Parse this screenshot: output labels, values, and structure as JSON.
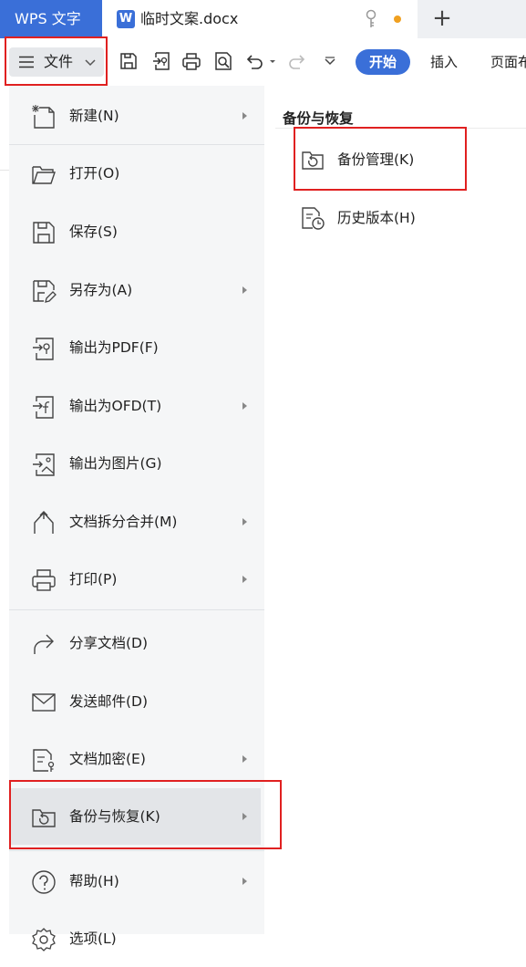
{
  "tabbar": {
    "app_title": "WPS 文字",
    "doc_icon_letter": "W",
    "doc_name": "临时文案.docx",
    "unsaved_dot_color": "#f0a020",
    "new_tab_symbol": "+"
  },
  "toolbar": {
    "file_label": "文件",
    "tabs": [
      "开始",
      "插入",
      "页面布"
    ],
    "accent_color": "#3a6fd8",
    "icons": [
      "save-icon",
      "export-pdf-icon",
      "print-icon",
      "print-preview-icon",
      "undo-icon",
      "undo-dropdown-icon",
      "redo-icon",
      "more-dropdown-icon"
    ]
  },
  "file_menu": {
    "items": [
      {
        "label": "新建(N)",
        "icon": "new-doc-icon",
        "has_submenu": true
      },
      {
        "label": "打开(O)",
        "icon": "folder-open-icon",
        "has_submenu": false
      },
      {
        "label": "保存(S)",
        "icon": "save-icon",
        "has_submenu": false
      },
      {
        "label": "另存为(A)",
        "icon": "save-as-icon",
        "has_submenu": true
      },
      {
        "label": "输出为PDF(F)",
        "icon": "export-pdf-icon",
        "has_submenu": false
      },
      {
        "label": "输出为OFD(T)",
        "icon": "export-ofd-icon",
        "has_submenu": true
      },
      {
        "label": "输出为图片(G)",
        "icon": "export-image-icon",
        "has_submenu": false
      },
      {
        "label": "文档拆分合并(M)",
        "icon": "split-merge-icon",
        "has_submenu": true
      },
      {
        "label": "打印(P)",
        "icon": "print-icon",
        "has_submenu": true
      },
      {
        "label": "分享文档(D)",
        "icon": "share-icon",
        "has_submenu": false
      },
      {
        "label": "发送邮件(D)",
        "icon": "mail-icon",
        "has_submenu": false
      },
      {
        "label": "文档加密(E)",
        "icon": "encrypt-icon",
        "has_submenu": true
      },
      {
        "label": "备份与恢复(K)",
        "icon": "backup-restore-icon",
        "has_submenu": true,
        "active": true
      },
      {
        "label": "帮助(H)",
        "icon": "help-icon",
        "has_submenu": true
      },
      {
        "label": "选项(L)",
        "icon": "options-icon",
        "has_submenu": false
      }
    ]
  },
  "submenu": {
    "title": "备份与恢复",
    "items": [
      {
        "label": "备份管理(K)",
        "icon": "backup-manage-icon"
      },
      {
        "label": "历史版本(H)",
        "icon": "history-version-icon"
      }
    ]
  },
  "highlight_color": "#e02020"
}
